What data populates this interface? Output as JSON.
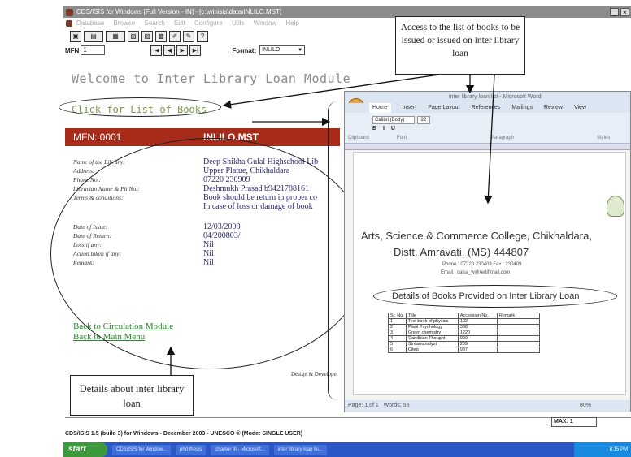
{
  "window": {
    "title": "CDS/ISIS for Windows [Full Version - IN] - [c:\\winisis\\data\\INLILO.MST]",
    "min": "_",
    "close": "×"
  },
  "menu": [
    "Database",
    "Browse",
    "Search",
    "Edit",
    "Configure",
    "Utils",
    "Window",
    "Help"
  ],
  "nav": {
    "mfn_label": "MFN",
    "mfn_value": "1",
    "format_label": "Format:",
    "format_value": "INLILO"
  },
  "module": {
    "welcome": "Welcome to Inter Library Loan Module",
    "click_list": "Click for List of Books",
    "mfn": "MFN: 0001",
    "db": "INLILO.MST",
    "records": [
      {
        "label": "Name of the Library:",
        "value": "Deep Shikha Gulal Highschool Lib"
      },
      {
        "label": "Address:",
        "value": "Upper Platue, Chikhaldara"
      },
      {
        "label": "Phone No.:",
        "value": "07220 230909"
      },
      {
        "label": "Librarian Name & Ph No.:",
        "value": "Deshmukh Prasad b9421788161"
      },
      {
        "label": "Terms & conditions:",
        "value": "Book should be return in proper co"
      },
      {
        "label": "",
        "value": "In case of loss or damage of book"
      },
      {
        "label": "Date of Issue:",
        "value": "12/03/2008"
      },
      {
        "label": "Date of Return:",
        "value": "04/200803/"
      },
      {
        "label": "Loss if any:",
        "value": "Nil"
      },
      {
        "label": "Action taken if any:",
        "value": "Nil"
      },
      {
        "label": "Remark:",
        "value": "Nil"
      }
    ],
    "link_circulation": "Back to Circulation Module",
    "link_main": "Back to Main Menu",
    "design": "Design & Develope"
  },
  "word": {
    "title": "inter library loan list - Microsoft Word",
    "tabs": [
      "Home",
      "Insert",
      "Page Layout",
      "References",
      "Mailings",
      "Review",
      "View"
    ],
    "font": "Calibri (Body)",
    "size": "22",
    "groups": [
      "Clipboard",
      "Font",
      "Paragraph",
      "Styles"
    ],
    "heading1": "Arts, Science & Commerce College, Chikhaldara,",
    "heading2": "Distt. Amravati. (MS) 444807",
    "phone": "Phone : 07220 230409 Fax : 230409",
    "email": "Email : caisa_w@rediffmail.com",
    "table_title": "Details of Books Provided on Inter Library Loan",
    "table_headers": [
      "Sr. No.",
      "Title",
      "Accession No.",
      "Remark"
    ],
    "table_rows": [
      [
        "1",
        "Text book of physics",
        "102",
        ""
      ],
      [
        "2",
        "Plant Psychology",
        "388",
        ""
      ],
      [
        "3",
        "Green chemistry",
        "1220",
        ""
      ],
      [
        "4",
        "Gandhian Thought",
        "900",
        ""
      ],
      [
        "5",
        "Streamanalyst",
        "209",
        ""
      ],
      [
        "6",
        "Citeg",
        "987",
        ""
      ]
    ],
    "status_page": "Page: 1 of 1",
    "status_words": "Words: 58",
    "zoom": "80%"
  },
  "annotations": {
    "top": "Access to the list of books to be issued or issued on inter library loan",
    "bottom": "Details about inter library loan"
  },
  "footer": {
    "max": "MAX: 1",
    "status": "CDS/ISIS 1.5 (build 3) for Windows - December 2003 - UNESCO © (Mode: SINGLE USER)"
  },
  "taskbar": {
    "start": "start",
    "items": [
      "CDS/ISIS for Window...",
      "phd thesis",
      "chapter III - Microsoft...",
      "inter library loan lis..."
    ],
    "clock": "8:15 PM"
  }
}
